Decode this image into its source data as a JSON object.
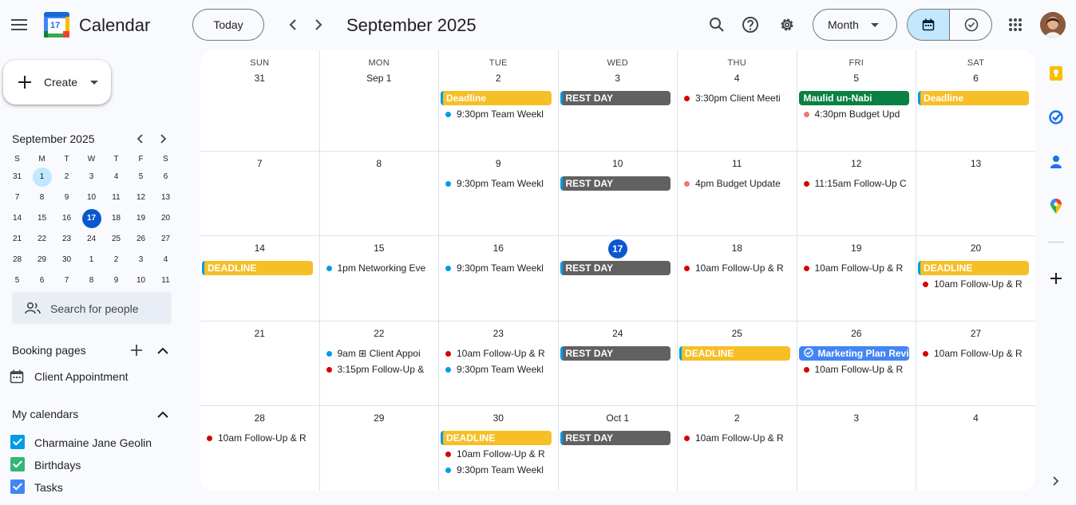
{
  "header": {
    "app_name": "Calendar",
    "logo_number": "17",
    "today_label": "Today",
    "current_period": "September 2025",
    "view_label": "Month"
  },
  "sidebar": {
    "create_label": "Create",
    "mini_month": "September 2025",
    "weekday_letters": [
      "S",
      "M",
      "T",
      "W",
      "T",
      "F",
      "S"
    ],
    "mini_weeks": [
      [
        "31",
        "1",
        "2",
        "3",
        "4",
        "5",
        "6"
      ],
      [
        "7",
        "8",
        "9",
        "10",
        "11",
        "12",
        "13"
      ],
      [
        "14",
        "15",
        "16",
        "17",
        "18",
        "19",
        "20"
      ],
      [
        "21",
        "22",
        "23",
        "24",
        "25",
        "26",
        "27"
      ],
      [
        "28",
        "29",
        "30",
        "1",
        "2",
        "3",
        "4"
      ],
      [
        "5",
        "6",
        "7",
        "8",
        "9",
        "10",
        "11"
      ]
    ],
    "search_people_placeholder": "Search for people",
    "booking_pages_label": "Booking pages",
    "booking_item": "Client Appointment",
    "my_calendars_label": "My calendars",
    "calendars": [
      {
        "name": "Charmaine Jane Geolin",
        "color": "#039be5"
      },
      {
        "name": "Birthdays",
        "color": "#33b679"
      },
      {
        "name": "Tasks",
        "color": "#4285f4"
      }
    ]
  },
  "month": {
    "weekdays": [
      "SUN",
      "MON",
      "TUE",
      "WED",
      "THU",
      "FRI",
      "SAT"
    ],
    "weeks": [
      [
        {
          "label": "31",
          "events": []
        },
        {
          "label": "Sep 1",
          "events": []
        },
        {
          "label": "2",
          "events": [
            {
              "kind": "pill",
              "text": "Deadline",
              "color": "#f6bf26",
              "edge": "#039be5"
            },
            {
              "kind": "timed",
              "text": "9:30pm Team Weekl",
              "color": "#039be5"
            }
          ]
        },
        {
          "label": "3",
          "events": [
            {
              "kind": "pill",
              "text": "REST DAY",
              "color": "#616161",
              "edge": "#039be5"
            }
          ]
        },
        {
          "label": "4",
          "events": [
            {
              "kind": "timed",
              "text": "3:30pm Client Meeti",
              "color": "#d50000"
            }
          ]
        },
        {
          "label": "5",
          "events": [
            {
              "kind": "pill",
              "text": "Maulid un-Nabi",
              "color": "#0b8043"
            },
            {
              "kind": "timed",
              "text": "4:30pm Budget Upd",
              "color": "#e67c73"
            }
          ]
        },
        {
          "label": "6",
          "events": [
            {
              "kind": "pill",
              "text": "Deadline",
              "color": "#f6bf26",
              "edge": "#039be5"
            }
          ]
        }
      ],
      [
        {
          "label": "7",
          "events": []
        },
        {
          "label": "8",
          "events": []
        },
        {
          "label": "9",
          "events": [
            {
              "kind": "timed",
              "text": "9:30pm Team Weekl",
              "color": "#039be5"
            }
          ]
        },
        {
          "label": "10",
          "events": [
            {
              "kind": "pill",
              "text": "REST DAY",
              "color": "#616161",
              "edge": "#039be5"
            }
          ]
        },
        {
          "label": "11",
          "events": [
            {
              "kind": "timed",
              "text": "4pm Budget Update",
              "color": "#e67c73"
            }
          ]
        },
        {
          "label": "12",
          "events": [
            {
              "kind": "timed",
              "text": "11:15am Follow-Up C",
              "color": "#d50000"
            }
          ]
        },
        {
          "label": "13",
          "events": []
        }
      ],
      [
        {
          "label": "14",
          "events": [
            {
              "kind": "pill",
              "text": "DEADLINE",
              "color": "#f6bf26",
              "edge": "#039be5"
            }
          ]
        },
        {
          "label": "15",
          "events": [
            {
              "kind": "timed",
              "text": "1pm Networking Eve",
              "color": "#039be5"
            }
          ]
        },
        {
          "label": "16",
          "events": [
            {
              "kind": "timed",
              "text": "9:30pm Team Weekl",
              "color": "#039be5"
            }
          ]
        },
        {
          "label": "17",
          "today": true,
          "events": [
            {
              "kind": "pill",
              "text": "REST DAY",
              "color": "#616161",
              "edge": "#039be5"
            }
          ]
        },
        {
          "label": "18",
          "events": [
            {
              "kind": "timed",
              "text": "10am Follow-Up & R",
              "color": "#d50000"
            }
          ]
        },
        {
          "label": "19",
          "events": [
            {
              "kind": "timed",
              "text": "10am Follow-Up & R",
              "color": "#d50000"
            }
          ]
        },
        {
          "label": "20",
          "events": [
            {
              "kind": "pill",
              "text": "DEADLINE",
              "color": "#f6bf26",
              "edge": "#039be5"
            },
            {
              "kind": "timed",
              "text": "10am Follow-Up & R",
              "color": "#d50000"
            }
          ]
        }
      ],
      [
        {
          "label": "21",
          "events": []
        },
        {
          "label": "22",
          "events": [
            {
              "kind": "timed",
              "text": "9am ⊞ Client Appoi",
              "color": "#039be5"
            },
            {
              "kind": "timed",
              "text": "3:15pm Follow-Up &",
              "color": "#d50000"
            }
          ]
        },
        {
          "label": "23",
          "events": [
            {
              "kind": "timed",
              "text": "10am Follow-Up & R",
              "color": "#d50000"
            },
            {
              "kind": "timed",
              "text": "9:30pm Team Weekl",
              "color": "#039be5"
            }
          ]
        },
        {
          "label": "24",
          "events": [
            {
              "kind": "pill",
              "text": "REST DAY",
              "color": "#616161",
              "edge": "#039be5"
            }
          ]
        },
        {
          "label": "25",
          "events": [
            {
              "kind": "pill",
              "text": "DEADLINE",
              "color": "#f6bf26",
              "edge": "#039be5"
            }
          ]
        },
        {
          "label": "26",
          "events": [
            {
              "kind": "task",
              "text": "Marketing Plan Revi",
              "color": "#4285f4"
            },
            {
              "kind": "timed",
              "text": "10am Follow-Up & R",
              "color": "#d50000"
            }
          ]
        },
        {
          "label": "27",
          "events": [
            {
              "kind": "timed",
              "text": "10am Follow-Up & R",
              "color": "#d50000"
            }
          ]
        }
      ],
      [
        {
          "label": "28",
          "events": [
            {
              "kind": "timed",
              "text": "10am Follow-Up & R",
              "color": "#d50000"
            }
          ]
        },
        {
          "label": "29",
          "events": []
        },
        {
          "label": "30",
          "events": [
            {
              "kind": "pill",
              "text": "DEADLINE",
              "color": "#f6bf26",
              "edge": "#039be5"
            },
            {
              "kind": "timed",
              "text": "10am Follow-Up & R",
              "color": "#d50000"
            },
            {
              "kind": "timed",
              "text": "9:30pm Team Weekl",
              "color": "#039be5"
            }
          ]
        },
        {
          "label": "Oct 1",
          "events": [
            {
              "kind": "pill",
              "text": "REST DAY",
              "color": "#616161",
              "edge": "#039be5"
            }
          ]
        },
        {
          "label": "2",
          "events": [
            {
              "kind": "timed",
              "text": "10am Follow-Up & R",
              "color": "#d50000"
            }
          ]
        },
        {
          "label": "3",
          "events": []
        },
        {
          "label": "4",
          "events": []
        }
      ]
    ]
  }
}
